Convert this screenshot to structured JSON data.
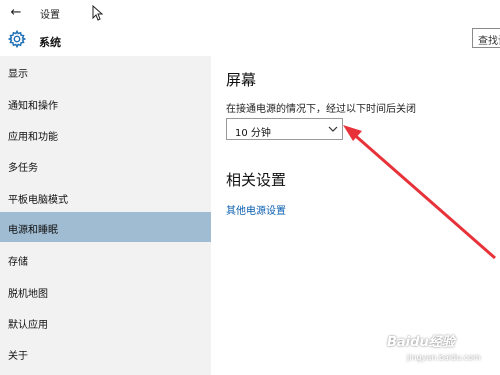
{
  "window": {
    "back_icon": "back-arrow-icon",
    "title": "设置"
  },
  "header": {
    "icon": "gear-icon",
    "section_title": "系统",
    "search_placeholder": "查找设"
  },
  "sidebar": {
    "items": [
      {
        "label": "显示"
      },
      {
        "label": "通知和操作"
      },
      {
        "label": "应用和功能"
      },
      {
        "label": "多任务"
      },
      {
        "label": "平板电脑模式"
      },
      {
        "label": "电源和睡眠",
        "active": true
      },
      {
        "label": "存储"
      },
      {
        "label": "脱机地图"
      },
      {
        "label": "默认应用"
      },
      {
        "label": "关于"
      }
    ]
  },
  "main": {
    "screen_heading": "屏幕",
    "sleep_label": "在接通电源的情况下，经过以下时间后关闭",
    "sleep_dropdown_value": "10 分钟",
    "related_heading": "相关设置",
    "power_link": "其他电源设置"
  },
  "colors": {
    "sidebar_bg": "#f2f2f2",
    "active_item": "#9fbcd3",
    "link": "#0a5fb0",
    "annotation_arrow": "#e8323a"
  },
  "watermark": {
    "logo": "Baidu经验",
    "url": "jingyan.baidu.com"
  }
}
